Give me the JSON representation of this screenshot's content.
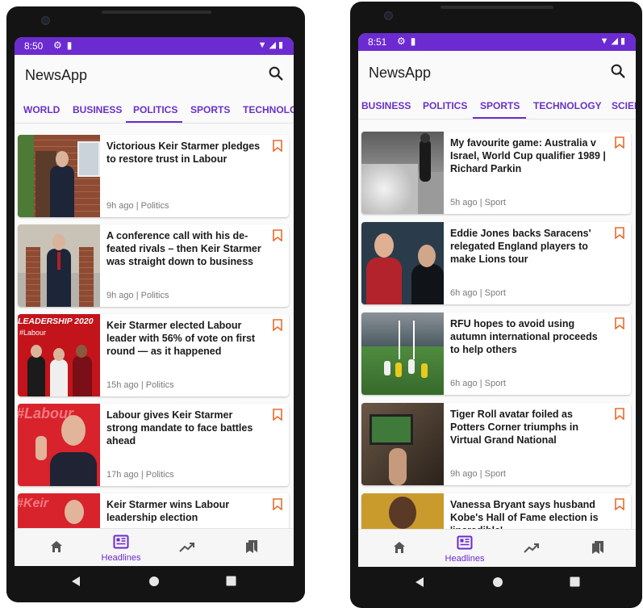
{
  "colors": {
    "accent": "#6b2bd0",
    "bookmark": "#e96a2c",
    "status_bar": "#6b2bd0"
  },
  "left": {
    "status": {
      "time": "8:50"
    },
    "app_title": "NewsApp",
    "tabs": [
      "WORLD",
      "BUSINESS",
      "POLITICS",
      "SPORTS",
      "TECHNOLO"
    ],
    "active_tab": "POLITICS",
    "articles": [
      {
        "title": "Victorious Keir Starmer pledges to restore trust in Labour",
        "time": "9h ago",
        "category": "Politics"
      },
      {
        "title": "A conference call with his de-feated rivals – then Keir Starmer was straight down to business",
        "time": "9h ago",
        "category": "Politics"
      },
      {
        "title": "Keir Starmer elected Labour leader with 56% of vote on first round — as it happened",
        "time": "15h ago",
        "category": "Politics",
        "image_text": "LEADERSHIP 2020",
        "image_subtext": "#Labour"
      },
      {
        "title": "Labour gives Keir Starmer strong mandate to face battles ahead",
        "time": "17h ago",
        "category": "Politics",
        "image_text": "#Labour"
      },
      {
        "title": "Keir Starmer wins Labour leadership election",
        "time": "",
        "category": "",
        "image_text": "#Keir"
      }
    ],
    "bottom_nav": {
      "active_label": "Headlines"
    }
  },
  "right": {
    "status": {
      "time": "8:51"
    },
    "app_title": "NewsApp",
    "tabs": [
      "BUSINESS",
      "POLITICS",
      "SPORTS",
      "TECHNOLOGY",
      "SCIEN"
    ],
    "active_tab": "SPORTS",
    "articles": [
      {
        "title": "My favourite game: Australia v Israel, World Cup qualifier 1989 | Richard Parkin",
        "time": "5h ago",
        "category": "Sport"
      },
      {
        "title": "Eddie Jones backs Saracens' relegated England players to make Lions tour",
        "time": "6h ago",
        "category": "Sport"
      },
      {
        "title": "RFU hopes to avoid using autumn international proceeds to help others",
        "time": "6h ago",
        "category": "Sport"
      },
      {
        "title": "Tiger Roll avatar foiled as Potters Corner triumphs in Virtual Grand National",
        "time": "9h ago",
        "category": "Sport"
      },
      {
        "title": "Vanessa Bryant says husband Kobe's Hall of Fame election is 'incredible'",
        "time": "",
        "category": ""
      }
    ],
    "bottom_nav": {
      "active_label": "Headlines"
    }
  }
}
